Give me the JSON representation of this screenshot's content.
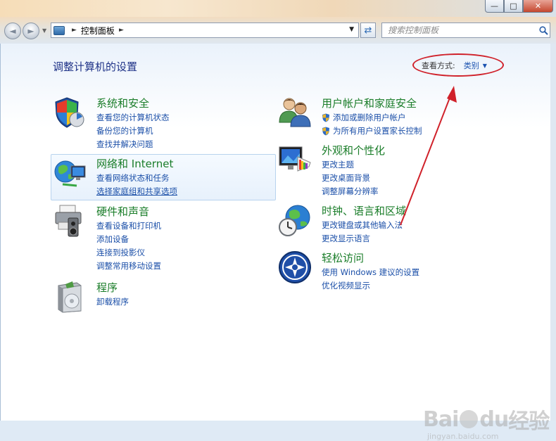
{
  "window": {
    "min_label": "—",
    "max_label": "□",
    "close_label": "✕"
  },
  "nav": {
    "back_label": "◄",
    "forward_label": "►",
    "address_crumb": "控制面板",
    "address_sep": "►",
    "refresh_label": "⇄",
    "search_placeholder": "搜索控制面板"
  },
  "main": {
    "heading": "调整计算机的设置",
    "view_by_label": "查看方式:",
    "view_by_value": "类别"
  },
  "categories": [
    {
      "title": "系统和安全",
      "icon": "system-security-icon",
      "links": [
        "查看您的计算机状态",
        "备份您的计算机",
        "查找并解决问题"
      ]
    },
    {
      "title": "网络和 Internet",
      "icon": "network-internet-icon",
      "links": [
        "查看网络状态和任务",
        "选择家庭组和共享选项"
      ]
    },
    {
      "title": "硬件和声音",
      "icon": "hardware-sound-icon",
      "links": [
        "查看设备和打印机",
        "添加设备",
        "连接到投影仪",
        "调整常用移动设置"
      ]
    },
    {
      "title": "程序",
      "icon": "programs-icon",
      "links": [
        "卸载程序"
      ]
    },
    {
      "title": "用户帐户和家庭安全",
      "icon": "user-accounts-icon",
      "links": [
        "添加或删除用户帐户",
        "为所有用户设置家长控制"
      ]
    },
    {
      "title": "外观和个性化",
      "icon": "appearance-icon",
      "links": [
        "更改主题",
        "更改桌面背景",
        "调整屏幕分辨率"
      ]
    },
    {
      "title": "时钟、语言和区域",
      "icon": "clock-language-icon",
      "links": [
        "更改键盘或其他输入法",
        "更改显示语言"
      ]
    },
    {
      "title": "轻松访问",
      "icon": "ease-of-access-icon",
      "links": [
        "使用 Windows 建议的设置",
        "优化视频显示"
      ]
    }
  ],
  "watermark": {
    "brand": "Bai",
    "brand2": "du",
    "brand3": "经验",
    "url": "jingyan.baidu.com"
  },
  "colors": {
    "category_title": "#1a7d29",
    "link": "#1b4fa8",
    "heading": "#1e3287",
    "annotation": "#d0212a"
  }
}
